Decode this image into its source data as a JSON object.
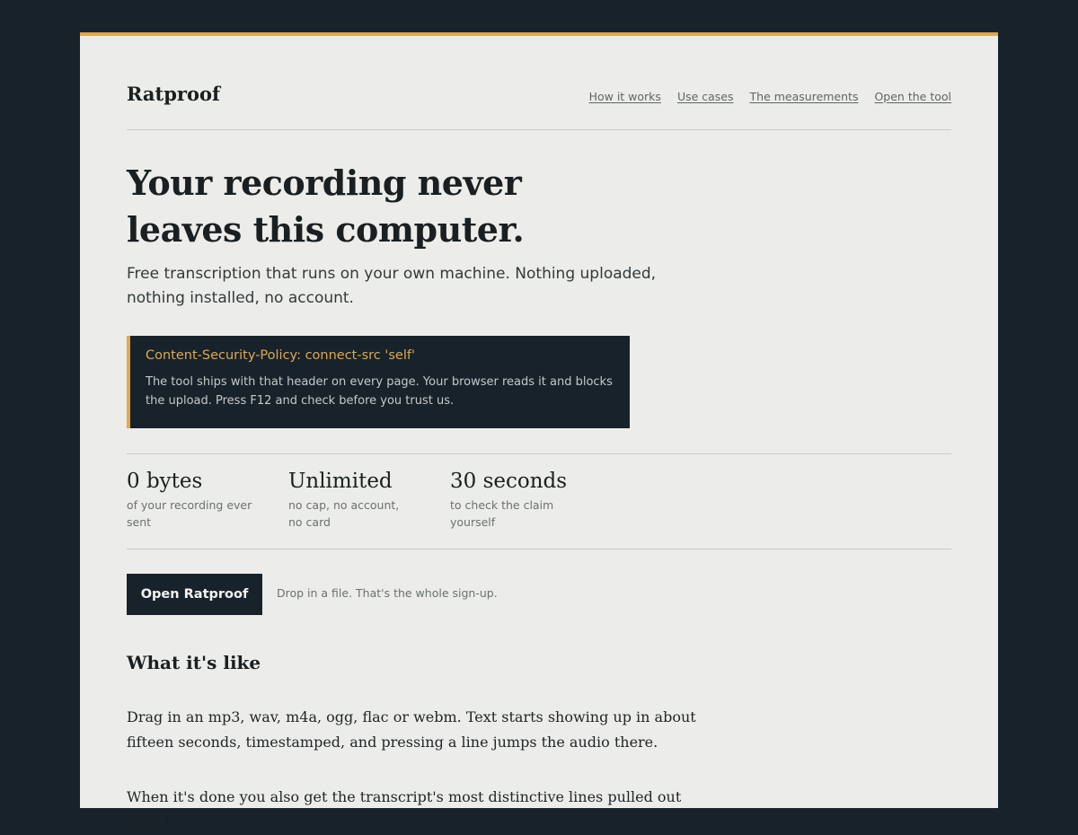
{
  "brand": {
    "name": "Ratproof"
  },
  "nav": {
    "items": [
      {
        "label": "How it works"
      },
      {
        "label": "Use cases"
      },
      {
        "label": "The measurements"
      },
      {
        "label": "Open the tool"
      }
    ]
  },
  "hero": {
    "title": "Your recording never leaves this computer.",
    "lede": "Free transcription that runs on your own machine. Nothing uploaded, nothing installed, no account."
  },
  "csp_callout": {
    "header": "Content-Security-Policy: connect-src 'self'",
    "body": "The tool ships with that header on every page. Your browser reads it and blocks the upload. Press F12 and check before you trust us."
  },
  "stats": [
    {
      "value": "0 bytes",
      "label": "of your recording ever sent"
    },
    {
      "value": "Unlimited",
      "label": "no cap, no account, no card"
    },
    {
      "value": "30 seconds",
      "label": "to check the claim yourself"
    }
  ],
  "cta": {
    "button_label": "Open Ratproof",
    "note": "Drop in a file. That's the whole sign-up."
  },
  "section": {
    "heading": "What it's like",
    "paragraphs": [
      "Drag in an mp3, wav, m4a, ogg, flac or webm. Text starts showing up in about fifteen seconds, timestamped, and pressing a line jumps the audio there.",
      "When it's done you also get the transcript's most distinctive lines pulled out word"
    ]
  },
  "colors": {
    "accent": "#e0a94a",
    "dark": "#18222b",
    "page_background": "#ecedea"
  }
}
